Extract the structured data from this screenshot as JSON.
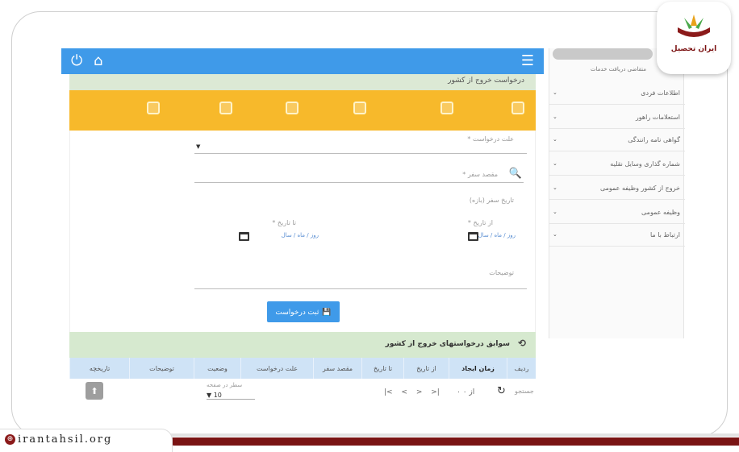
{
  "header_strip": "درخواست خروج از کشور",
  "form": {
    "reason_label": "علت درخواست *",
    "destination_label": "مقصد سفر *",
    "travel_date_label": "تاریخ سفر (بازه)",
    "from_label": "از تاریخ *",
    "to_label": "تا تاریخ *",
    "date_hint": "روز / ماه / سال",
    "notes_label": "توضیحات",
    "submit_label": "ثبت درخواست"
  },
  "history": {
    "title": "سوابق درخواستهای خروج از کشور",
    "columns": [
      "ردیف",
      "زمان ایجاد",
      "از تاریخ",
      "تا تاریخ",
      "مقصد سفر",
      "علت درخواست",
      "وضعیت",
      "توضیحات",
      "تاریخچه"
    ],
    "pager": "|< < > >|",
    "pages": "۰ از ۰",
    "search_label": "جستجو",
    "rows_per_page_label": "سطر در صفحه",
    "rows_per_page_value": "10"
  },
  "sidebar": {
    "role": "متقاضی دریافت خدمات",
    "items": [
      "اطلاعات فردی",
      "استعلامات راهور",
      "گواهی نامه رانندگی",
      "شماره گذاری وسایل نقلیه",
      "خروج از کشور وظیفه عمومی",
      "وظیفه عمومی",
      "ارتباط با ما"
    ]
  },
  "logo_text": "ایران تحصیل",
  "footer_url": "irantahsil.org",
  "colors": {
    "primary": "#3f9ae9",
    "steps": "#f7b92b",
    "brand": "#7a1414"
  }
}
